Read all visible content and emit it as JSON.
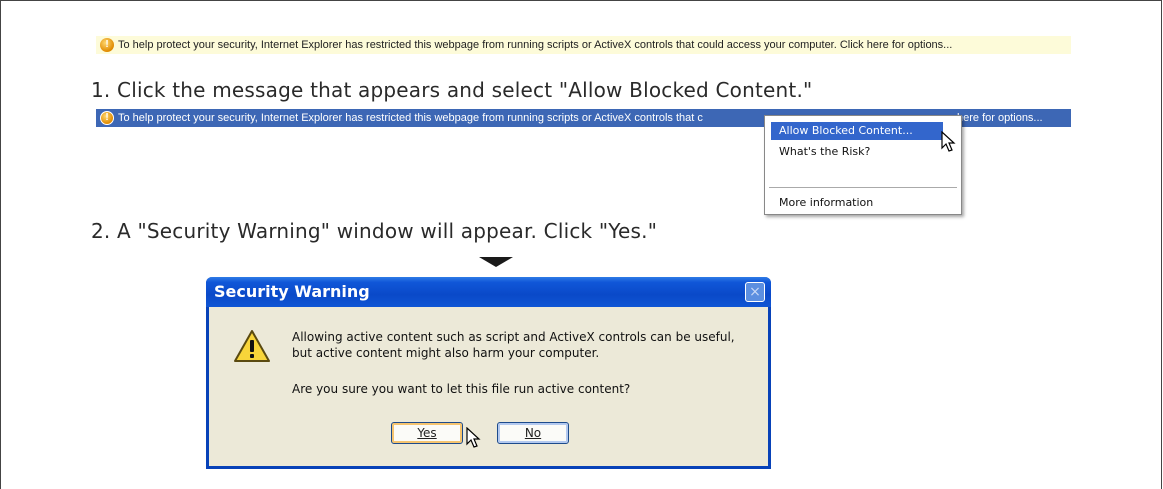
{
  "infobar_text": "To help protect your security, Internet Explorer has restricted this webpage from running scripts or ActiveX controls that could access your computer. Click here for options...",
  "infobar_text_highlighted_left": "To help protect your security, Internet Explorer has restricted this webpage from running scripts or ActiveX controls that c",
  "infobar_text_highlighted_right": "here for options...",
  "step1": "1. Click the message that appears and select \"Allow Blocked Content.\"",
  "step2": "2. A \"Security Warning\" window will appear.  Click \"Yes.\"",
  "menu": {
    "items": [
      "Allow Blocked Content...",
      "What's the Risk?",
      "More information"
    ]
  },
  "dialog": {
    "title": "Security Warning",
    "close_glyph": "×",
    "line1": "Allowing active content such as script and ActiveX controls can be useful,",
    "line2": "but active content might also harm your computer.",
    "question": "Are you sure you want to let this file run active content?",
    "yes_label": "Yes",
    "no_label": "No"
  },
  "icons": {
    "shield_glyph": "!",
    "warning_glyph": "!"
  },
  "colors": {
    "infobar_bg": "#fdfbd9",
    "infobar_selected_bg": "#3d67b5",
    "titlebar": "#0a49c8",
    "dialog_bg": "#ece9d8",
    "menu_highlight": "#3366cc"
  }
}
